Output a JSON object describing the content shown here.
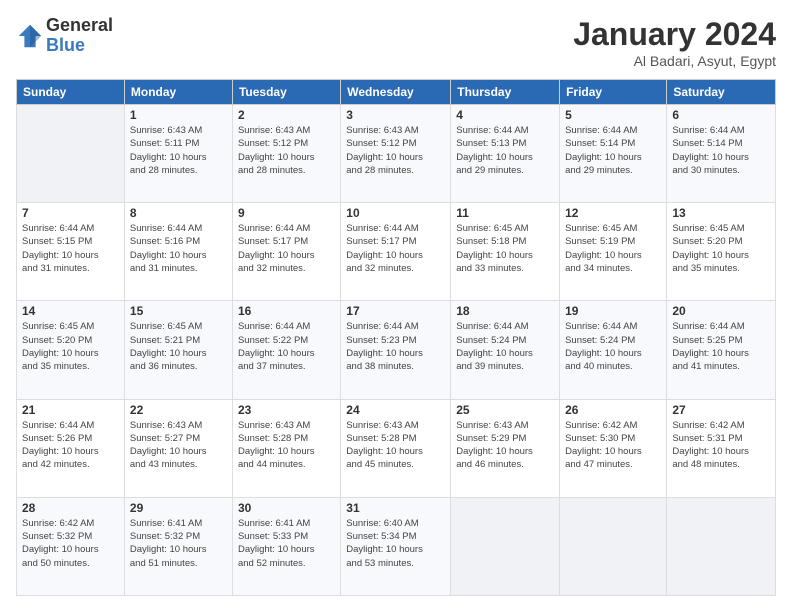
{
  "header": {
    "logo_general": "General",
    "logo_blue": "Blue",
    "month": "January 2024",
    "location": "Al Badari, Asyut, Egypt"
  },
  "weekdays": [
    "Sunday",
    "Monday",
    "Tuesday",
    "Wednesday",
    "Thursday",
    "Friday",
    "Saturday"
  ],
  "weeks": [
    [
      {
        "num": "",
        "info": ""
      },
      {
        "num": "1",
        "info": "Sunrise: 6:43 AM\nSunset: 5:11 PM\nDaylight: 10 hours\nand 28 minutes."
      },
      {
        "num": "2",
        "info": "Sunrise: 6:43 AM\nSunset: 5:12 PM\nDaylight: 10 hours\nand 28 minutes."
      },
      {
        "num": "3",
        "info": "Sunrise: 6:43 AM\nSunset: 5:12 PM\nDaylight: 10 hours\nand 28 minutes."
      },
      {
        "num": "4",
        "info": "Sunrise: 6:44 AM\nSunset: 5:13 PM\nDaylight: 10 hours\nand 29 minutes."
      },
      {
        "num": "5",
        "info": "Sunrise: 6:44 AM\nSunset: 5:14 PM\nDaylight: 10 hours\nand 29 minutes."
      },
      {
        "num": "6",
        "info": "Sunrise: 6:44 AM\nSunset: 5:14 PM\nDaylight: 10 hours\nand 30 minutes."
      }
    ],
    [
      {
        "num": "7",
        "info": "Sunrise: 6:44 AM\nSunset: 5:15 PM\nDaylight: 10 hours\nand 31 minutes."
      },
      {
        "num": "8",
        "info": "Sunrise: 6:44 AM\nSunset: 5:16 PM\nDaylight: 10 hours\nand 31 minutes."
      },
      {
        "num": "9",
        "info": "Sunrise: 6:44 AM\nSunset: 5:17 PM\nDaylight: 10 hours\nand 32 minutes."
      },
      {
        "num": "10",
        "info": "Sunrise: 6:44 AM\nSunset: 5:17 PM\nDaylight: 10 hours\nand 32 minutes."
      },
      {
        "num": "11",
        "info": "Sunrise: 6:45 AM\nSunset: 5:18 PM\nDaylight: 10 hours\nand 33 minutes."
      },
      {
        "num": "12",
        "info": "Sunrise: 6:45 AM\nSunset: 5:19 PM\nDaylight: 10 hours\nand 34 minutes."
      },
      {
        "num": "13",
        "info": "Sunrise: 6:45 AM\nSunset: 5:20 PM\nDaylight: 10 hours\nand 35 minutes."
      }
    ],
    [
      {
        "num": "14",
        "info": "Sunrise: 6:45 AM\nSunset: 5:20 PM\nDaylight: 10 hours\nand 35 minutes."
      },
      {
        "num": "15",
        "info": "Sunrise: 6:45 AM\nSunset: 5:21 PM\nDaylight: 10 hours\nand 36 minutes."
      },
      {
        "num": "16",
        "info": "Sunrise: 6:44 AM\nSunset: 5:22 PM\nDaylight: 10 hours\nand 37 minutes."
      },
      {
        "num": "17",
        "info": "Sunrise: 6:44 AM\nSunset: 5:23 PM\nDaylight: 10 hours\nand 38 minutes."
      },
      {
        "num": "18",
        "info": "Sunrise: 6:44 AM\nSunset: 5:24 PM\nDaylight: 10 hours\nand 39 minutes."
      },
      {
        "num": "19",
        "info": "Sunrise: 6:44 AM\nSunset: 5:24 PM\nDaylight: 10 hours\nand 40 minutes."
      },
      {
        "num": "20",
        "info": "Sunrise: 6:44 AM\nSunset: 5:25 PM\nDaylight: 10 hours\nand 41 minutes."
      }
    ],
    [
      {
        "num": "21",
        "info": "Sunrise: 6:44 AM\nSunset: 5:26 PM\nDaylight: 10 hours\nand 42 minutes."
      },
      {
        "num": "22",
        "info": "Sunrise: 6:43 AM\nSunset: 5:27 PM\nDaylight: 10 hours\nand 43 minutes."
      },
      {
        "num": "23",
        "info": "Sunrise: 6:43 AM\nSunset: 5:28 PM\nDaylight: 10 hours\nand 44 minutes."
      },
      {
        "num": "24",
        "info": "Sunrise: 6:43 AM\nSunset: 5:28 PM\nDaylight: 10 hours\nand 45 minutes."
      },
      {
        "num": "25",
        "info": "Sunrise: 6:43 AM\nSunset: 5:29 PM\nDaylight: 10 hours\nand 46 minutes."
      },
      {
        "num": "26",
        "info": "Sunrise: 6:42 AM\nSunset: 5:30 PM\nDaylight: 10 hours\nand 47 minutes."
      },
      {
        "num": "27",
        "info": "Sunrise: 6:42 AM\nSunset: 5:31 PM\nDaylight: 10 hours\nand 48 minutes."
      }
    ],
    [
      {
        "num": "28",
        "info": "Sunrise: 6:42 AM\nSunset: 5:32 PM\nDaylight: 10 hours\nand 50 minutes."
      },
      {
        "num": "29",
        "info": "Sunrise: 6:41 AM\nSunset: 5:32 PM\nDaylight: 10 hours\nand 51 minutes."
      },
      {
        "num": "30",
        "info": "Sunrise: 6:41 AM\nSunset: 5:33 PM\nDaylight: 10 hours\nand 52 minutes."
      },
      {
        "num": "31",
        "info": "Sunrise: 6:40 AM\nSunset: 5:34 PM\nDaylight: 10 hours\nand 53 minutes."
      },
      {
        "num": "",
        "info": ""
      },
      {
        "num": "",
        "info": ""
      },
      {
        "num": "",
        "info": ""
      }
    ]
  ]
}
